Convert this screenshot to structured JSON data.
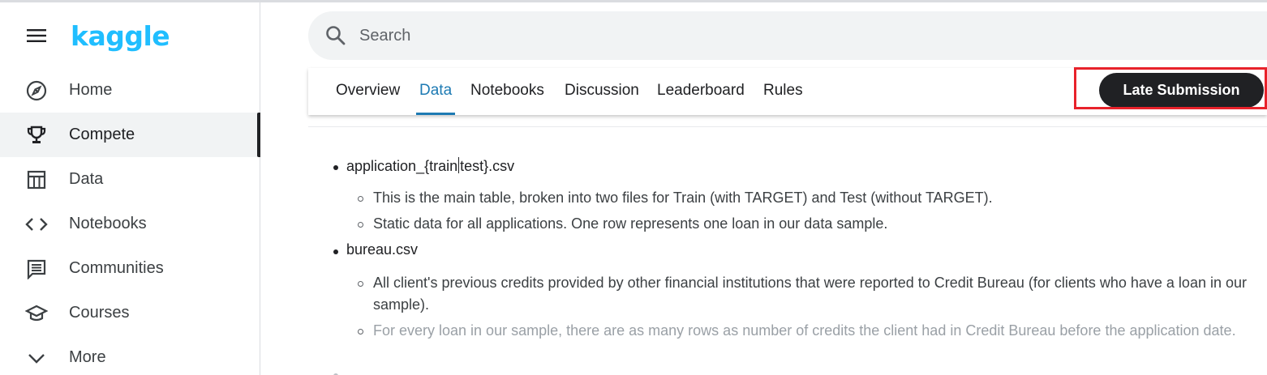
{
  "app": {
    "logo": "kaggle"
  },
  "sidebar": {
    "items": [
      {
        "label": "Home",
        "icon": "compass-icon"
      },
      {
        "label": "Compete",
        "icon": "trophy-icon",
        "active": true
      },
      {
        "label": "Data",
        "icon": "table-icon"
      },
      {
        "label": "Notebooks",
        "icon": "code-icon"
      },
      {
        "label": "Communities",
        "icon": "comment-icon"
      },
      {
        "label": "Courses",
        "icon": "graduation-cap-icon"
      },
      {
        "label": "More",
        "icon": "chevron-down-icon"
      }
    ]
  },
  "search": {
    "placeholder": "Search"
  },
  "tabs": [
    {
      "label": "Overview"
    },
    {
      "label": "Data",
      "active": true
    },
    {
      "label": "Notebooks"
    },
    {
      "label": "Discussion"
    },
    {
      "label": "Leaderboard"
    },
    {
      "label": "Rules"
    }
  ],
  "actions": {
    "late_submission": "Late Submission"
  },
  "content": {
    "files": [
      {
        "name_part1": "application_{train",
        "name_part2": "test}.csv",
        "details": [
          "This is the main table, broken into two files for Train (with TARGET) and Test (without TARGET).",
          "Static data for all applications. One row represents one loan in our data sample."
        ]
      },
      {
        "name": "bureau.csv",
        "details": [
          "All client's previous credits provided by other financial institutions that were reported to Credit Bureau (for clients who have a loan in our sample).",
          "For every loan in our sample, there are as many rows as number of credits the client had in Credit Bureau before the application date."
        ]
      }
    ]
  },
  "colors": {
    "brand": "#20beff",
    "accent": "#1d7ab3",
    "highlight": "#e8222b"
  }
}
